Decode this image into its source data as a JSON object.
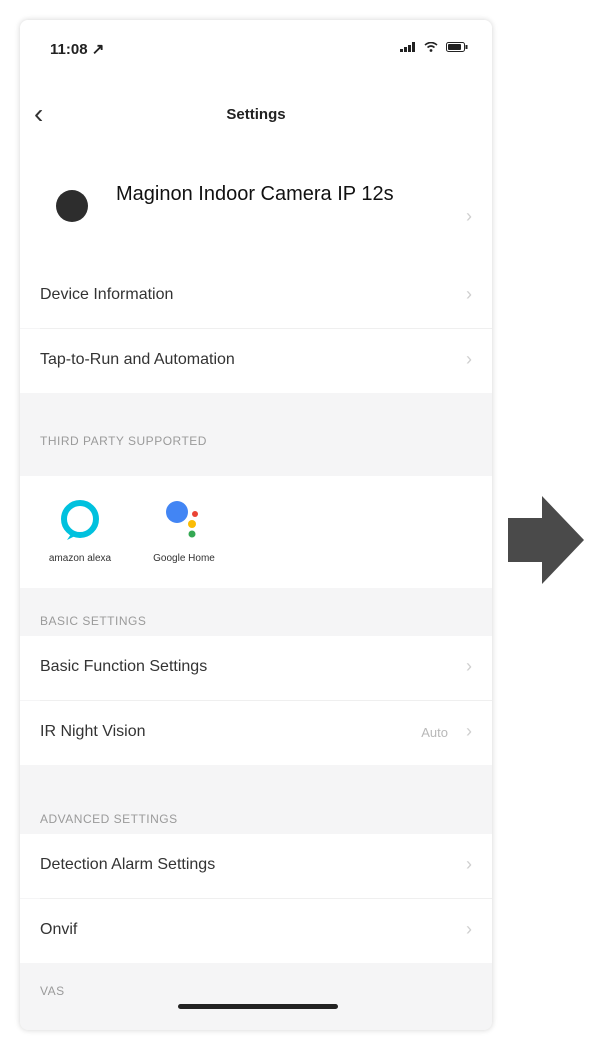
{
  "status": {
    "time": "11:08 ↗"
  },
  "nav": {
    "title": "Settings"
  },
  "device": {
    "name": "Maginon Indoor Camera IP 12s"
  },
  "rows": {
    "device_information": "Device Information",
    "tap_to_run": "Tap-to-Run and Automation",
    "basic_function": "Basic Function Settings",
    "ir_night_vision": "IR Night Vision",
    "ir_value": "Auto",
    "detection_alarm": "Detection Alarm Settings",
    "onvif": "Onvif"
  },
  "sections": {
    "third_party": "THIRD PARTY SUPPORTED",
    "basic": "BASIC SETTINGS",
    "advanced": "ADVANCED SETTINGS",
    "vas": "VAS"
  },
  "assistants": [
    {
      "caption": "amazon alexa"
    },
    {
      "caption": "Google Home"
    }
  ],
  "colors": {
    "arrow": "#4a4a4a",
    "alexa": "#00c1de",
    "google_blue": "#4285f4"
  }
}
